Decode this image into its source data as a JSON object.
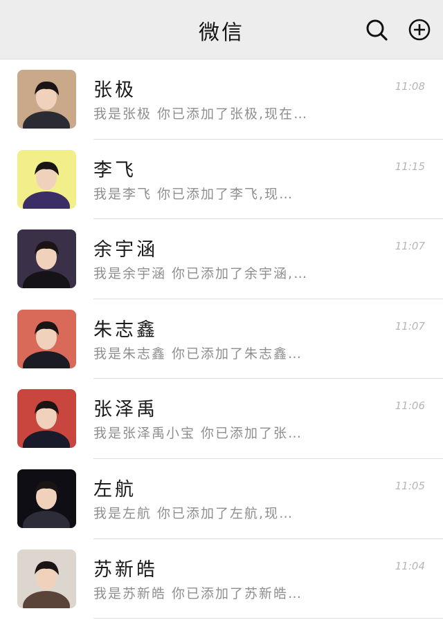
{
  "header": {
    "title": "微信",
    "search_icon": "search-icon",
    "add_icon": "plus-circle-icon"
  },
  "chats": [
    {
      "name": "张极",
      "time": "11:08",
      "preview": "我是张极 你已添加了张极,现在…",
      "avatar_bg": "#c9a98a",
      "avatar_fg": "#2b2b33"
    },
    {
      "name": "李飞",
      "time": "11:15",
      "preview": "我是李飞 你已添加了李飞,现…",
      "avatar_bg": "#f2ef8a",
      "avatar_fg": "#3b2e66"
    },
    {
      "name": "余宇涵",
      "time": "11:07",
      "preview": "我是余宇涵 你已添加了余宇涵,…",
      "avatar_bg": "#3a3048",
      "avatar_fg": "#151218"
    },
    {
      "name": "朱志鑫",
      "time": "11:07",
      "preview": "我是朱志鑫 你已添加了朱志鑫…",
      "avatar_bg": "#d96a5a",
      "avatar_fg": "#1b1b24"
    },
    {
      "name": "张泽禹",
      "time": "11:06",
      "preview": "我是张泽禹小宝 你已添加了张…",
      "avatar_bg": "#c8463e",
      "avatar_fg": "#1a1b2a"
    },
    {
      "name": "左航",
      "time": "11:05",
      "preview": "我是左航 你已添加了左航,现…",
      "avatar_bg": "#0e0e14",
      "avatar_fg": "#2d2d3a"
    },
    {
      "name": "苏新皓",
      "time": "11:04",
      "preview": "我是苏新皓 你已添加了苏新皓…",
      "avatar_bg": "#dcd6cf",
      "avatar_fg": "#5a4338"
    }
  ]
}
